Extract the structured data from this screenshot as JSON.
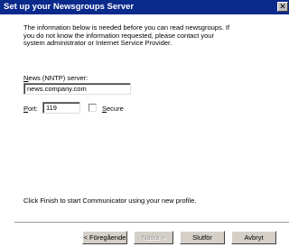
{
  "window": {
    "title": "Set up your Newsgroups Server",
    "close_glyph": "✕"
  },
  "content": {
    "intro_lines": [
      "The information below is needed before you can read newsgroups.  If",
      "you do not know the information requested, please contact your",
      "system administrator or Internet Service Provider."
    ],
    "server_label_prefix": "N",
    "server_label_rest": "ews (NNTP) server:",
    "server_value": "news.company.com",
    "port_label_prefix": "P",
    "port_label_rest": "ort:",
    "port_value": "119",
    "secure_label_prefix": "S",
    "secure_label_rest": "ecure",
    "secure_checked": false,
    "finish_text": "Click Finish to start Communicator using your new profile."
  },
  "buttons": {
    "back_label": "< Föregående",
    "next_label": "Nästa >",
    "finish_label": "Slutför",
    "cancel_label": "Avbryt"
  }
}
